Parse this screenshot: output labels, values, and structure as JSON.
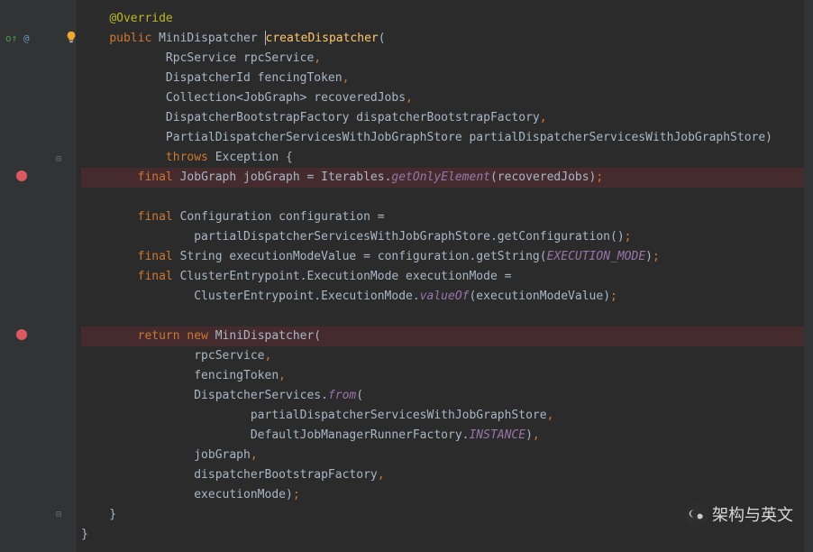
{
  "code": {
    "l1_annotation": "@Override",
    "l2_public": "public",
    "l2_type": " MiniDispatcher ",
    "l2_method": "createDispatcher",
    "l2_open": "(",
    "l3": "            RpcService rpcService",
    "l3_comma": ",",
    "l4": "            DispatcherId fencingToken",
    "l4_comma": ",",
    "l5": "            Collection<JobGraph> recoveredJobs",
    "l5_comma": ",",
    "l6": "            DispatcherBootstrapFactory dispatcherBootstrapFactory",
    "l6_comma": ",",
    "l7": "            PartialDispatcherServicesWithJobGraphStore partialDispatcherServicesWithJobGraphStore)",
    "l8_throws": "throws",
    "l8_rest": " Exception {",
    "l9_final": "final",
    "l9_mid": " JobGraph jobGraph = Iterables.",
    "l9_static": "getOnlyElement",
    "l9_end": "(recoveredJobs)",
    "l9_semi": ";",
    "l11_final": "final",
    "l11_rest": " Configuration configuration =",
    "l12": "                partialDispatcherServicesWithJobGraphStore.getConfiguration()",
    "l12_semi": ";",
    "l13_final": "final",
    "l13_mid": " String executionModeValue = configuration.getString(",
    "l13_field": "EXECUTION_MODE",
    "l13_close": ")",
    "l13_semi": ";",
    "l14_final": "final",
    "l14_rest": " ClusterEntrypoint.ExecutionMode executionMode =",
    "l15_pre": "                ClusterEntrypoint.ExecutionMode.",
    "l15_static": "valueOf",
    "l15_end": "(executionModeValue)",
    "l15_semi": ";",
    "l17_return": "return",
    "l17_new": " new",
    "l17_rest": " MiniDispatcher(",
    "l18": "                rpcService",
    "l18_comma": ",",
    "l19": "                fencingToken",
    "l19_comma": ",",
    "l20_pre": "                DispatcherServices.",
    "l20_static": "from",
    "l20_open": "(",
    "l21": "                        partialDispatcherServicesWithJobGraphStore",
    "l21_comma": ",",
    "l22_pre": "                        DefaultJobManagerRunnerFactory.",
    "l22_field": "INSTANCE",
    "l22_close": ")",
    "l22_comma": ",",
    "l23": "                jobGraph",
    "l23_comma": ",",
    "l24": "                dispatcherBootstrapFactory",
    "l24_comma": ",",
    "l25": "                executionMode)",
    "l25_semi": ";",
    "l26": "    }",
    "l27": "}"
  },
  "watermark": {
    "text": "架构与英文"
  },
  "gutter": {
    "override_symbol": "@",
    "override_arrow": "o↑"
  }
}
